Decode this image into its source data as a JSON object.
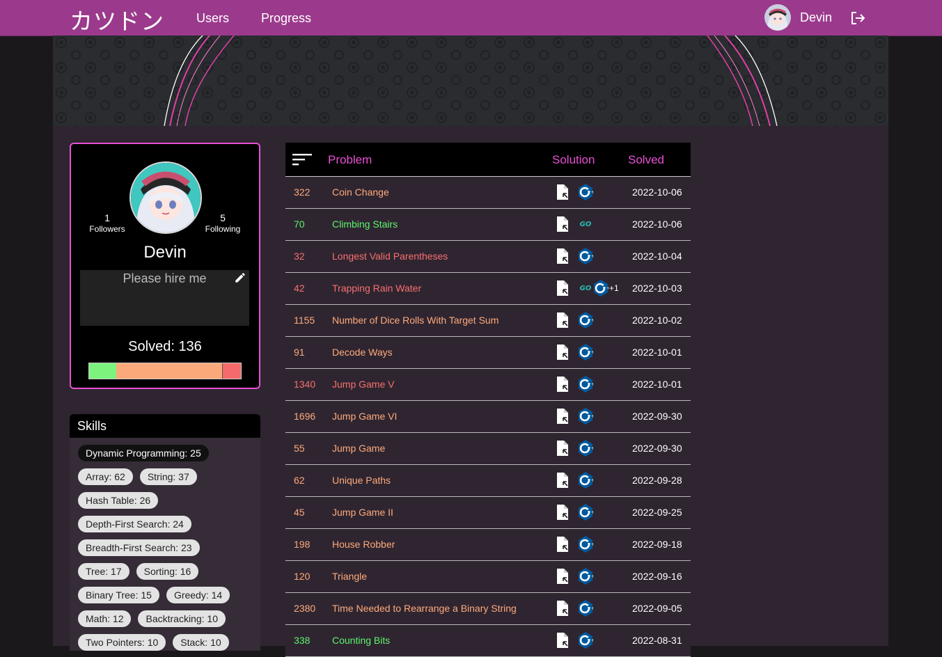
{
  "nav": {
    "brand": "カツドン",
    "links": [
      "Users",
      "Progress"
    ],
    "username": "Devin"
  },
  "profile": {
    "followers_count": "1",
    "followers_label": "Followers",
    "following_count": "5",
    "following_label": "Following",
    "name": "Devin",
    "bio_placeholder": "Please hire me",
    "solved_text": "Solved: 136",
    "difficulty_split": {
      "easy": 0.18,
      "medium": 0.7,
      "hard": 0.12
    },
    "colors": {
      "easy": "#7cf37c",
      "medium": "#fba97a",
      "hard": "#f56b6b"
    }
  },
  "skills": {
    "title": "Skills",
    "chips": [
      "Dynamic Programming: 25",
      "Array: 62",
      "String: 37",
      "Hash Table: 26",
      "Depth-First Search: 24",
      "Breadth-First Search: 23",
      "Tree: 17",
      "Sorting: 16",
      "Binary Tree: 15",
      "Greedy: 14",
      "Math: 12",
      "Backtracking: 10",
      "Two Pointers: 10",
      "Stack: 10"
    ]
  },
  "table": {
    "headers": {
      "problem": "Problem",
      "solution": "Solution",
      "solved": "Solved"
    },
    "difficulty_colors": {
      "easy": "#5cf56b",
      "medium": "#ffab7a",
      "hard": "#f7706e"
    },
    "rows": [
      {
        "id": "322",
        "name": "Coin Change",
        "difficulty": "medium",
        "langs": [
          "cpp"
        ],
        "more": "",
        "date": "2022-10-06"
      },
      {
        "id": "70",
        "name": "Climbing Stairs",
        "difficulty": "easy",
        "langs": [
          "go"
        ],
        "more": "",
        "date": "2022-10-06"
      },
      {
        "id": "32",
        "name": "Longest Valid Parentheses",
        "difficulty": "hard",
        "langs": [
          "cpp"
        ],
        "more": "",
        "date": "2022-10-04"
      },
      {
        "id": "42",
        "name": "Trapping Rain Water",
        "difficulty": "hard",
        "langs": [
          "go",
          "cpp"
        ],
        "more": "+1",
        "date": "2022-10-03"
      },
      {
        "id": "1155",
        "name": "Number of Dice Rolls With Target Sum",
        "difficulty": "medium",
        "langs": [
          "cpp"
        ],
        "more": "",
        "date": "2022-10-02"
      },
      {
        "id": "91",
        "name": "Decode Ways",
        "difficulty": "medium",
        "langs": [
          "cpp"
        ],
        "more": "",
        "date": "2022-10-01"
      },
      {
        "id": "1340",
        "name": "Jump Game V",
        "difficulty": "hard",
        "langs": [
          "cpp"
        ],
        "more": "",
        "date": "2022-10-01"
      },
      {
        "id": "1696",
        "name": "Jump Game VI",
        "difficulty": "medium",
        "langs": [
          "cpp"
        ],
        "more": "",
        "date": "2022-09-30"
      },
      {
        "id": "55",
        "name": "Jump Game",
        "difficulty": "medium",
        "langs": [
          "cpp"
        ],
        "more": "",
        "date": "2022-09-30"
      },
      {
        "id": "62",
        "name": "Unique Paths",
        "difficulty": "medium",
        "langs": [
          "cpp"
        ],
        "more": "",
        "date": "2022-09-28"
      },
      {
        "id": "45",
        "name": "Jump Game II",
        "difficulty": "medium",
        "langs": [
          "cpp"
        ],
        "more": "",
        "date": "2022-09-25"
      },
      {
        "id": "198",
        "name": "House Robber",
        "difficulty": "medium",
        "langs": [
          "cpp"
        ],
        "more": "",
        "date": "2022-09-18"
      },
      {
        "id": "120",
        "name": "Triangle",
        "difficulty": "medium",
        "langs": [
          "cpp"
        ],
        "more": "",
        "date": "2022-09-16"
      },
      {
        "id": "2380",
        "name": "Time Needed to Rearrange a Binary String",
        "difficulty": "medium",
        "langs": [
          "cpp"
        ],
        "more": "",
        "date": "2022-09-05"
      },
      {
        "id": "338",
        "name": "Counting Bits",
        "difficulty": "easy",
        "langs": [
          "cpp"
        ],
        "more": "",
        "date": "2022-08-31"
      }
    ]
  }
}
